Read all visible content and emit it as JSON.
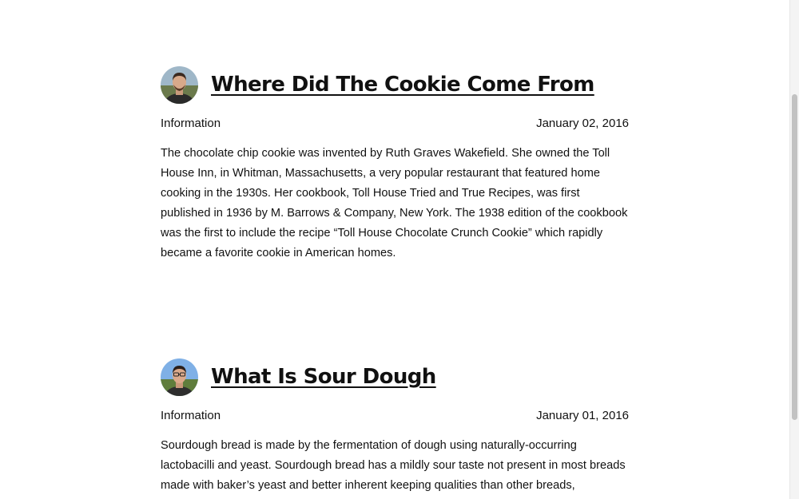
{
  "posts": [
    {
      "title": " Where Did The Cookie Come From",
      "category": "Information",
      "date": "January 02, 2016",
      "excerpt": "The chocolate chip cookie was invented by Ruth Graves Wakefield. She owned the Toll House Inn, in Whitman, Massachusetts, a very popular restaurant that featured home cooking in the 1930s. Her cookbook, Toll House Tried and True Recipes, was first published in 1936 by M. Barrows & Company, New York. The 1938 edition of the cookbook was the first to include the recipe “Toll House Chocolate Crunch Cookie” which rapidly became a favorite cookie in American homes."
    },
    {
      "title": " What Is Sour Dough",
      "category": "Information",
      "date": "January 01, 2016",
      "excerpt": "Sourdough bread is made by the fermentation of dough using naturally-occurring lactobacilli and yeast. Sourdough bread has a mildly sour taste not present in most breads made with baker’s yeast and better inherent keeping qualities than other breads,"
    }
  ]
}
